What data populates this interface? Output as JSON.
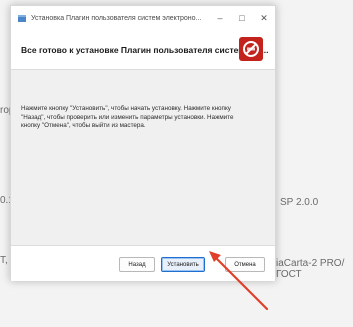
{
  "background": {
    "left_fragment_1": "rop",
    "left_fragment_2": "0.1",
    "left_fragment_3": "T,",
    "right_fragment_1": "SP 2.0.0",
    "right_fragment_2": "iaCarta-2 PRO/ГОСТ"
  },
  "dialog": {
    "window_title": "Установка Плагин пользователя систем электроно...",
    "minimize_glyph": "–",
    "maximize_glyph": "□",
    "close_glyph": "✕",
    "header_title": "Все готово к установке Плагин пользователя систем эле...",
    "body_text": "Нажмите кнопку \"Установить\", чтобы начать установку. Нажмите кнопку \"Назад\", чтобы проверить или изменить параметры установки. Нажмите кнопку \"Отмена\", чтобы выйти из мастера.",
    "buttons": {
      "back": "Назад",
      "install": "Установить",
      "cancel": "Отмена"
    }
  },
  "colors": {
    "arrow": "#e0402a",
    "logo_red": "#c4221c",
    "primary_border": "#1e6fcf"
  },
  "icons": {
    "app": "installer-box-icon",
    "header_logo": "red-prohibition-logo-icon"
  }
}
